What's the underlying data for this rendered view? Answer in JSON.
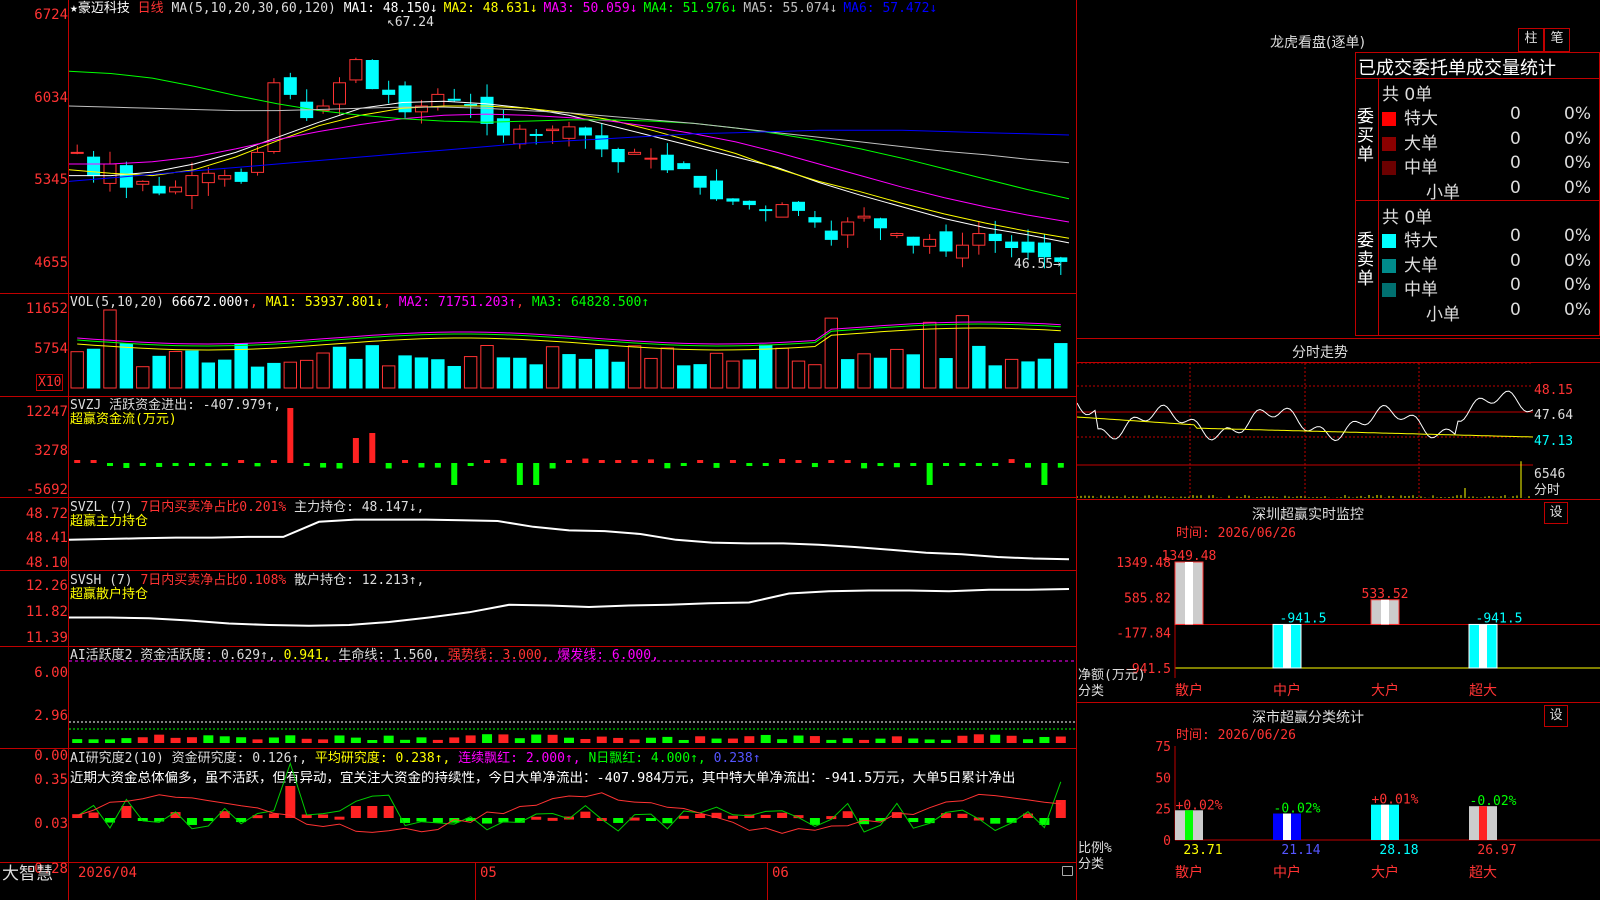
{
  "header": {
    "stock_name": "★豪迈科技",
    "period": "日线",
    "ma_label": "MA(5,10,20,30,60,120)",
    "ma_values": [
      {
        "text": "MA1: 48.150↓",
        "color": "#ffffff"
      },
      {
        "text": "MA2: 48.631↓",
        "color": "#ffff00"
      },
      {
        "text": "MA3: 50.059↓",
        "color": "#ff00ff"
      },
      {
        "text": "MA4: 51.976↓",
        "color": "#00ff00"
      },
      {
        "text": "MA5: 55.074↓",
        "color": "#c0c0c0"
      },
      {
        "text": "MA6: 57.472↓",
        "color": "#0000ff"
      }
    ],
    "high_mark": "67.24",
    "low_mark": "46.55"
  },
  "axes": {
    "price": [
      "6724",
      "6034",
      "5345",
      "4655"
    ],
    "vol": [
      "11652",
      "5754",
      "X10"
    ],
    "svzj": [
      "12247",
      "3278",
      "-5692"
    ],
    "svzl": [
      "48.72",
      "48.41",
      "48.10"
    ],
    "svsh": [
      "12.26",
      "11.82",
      "11.39"
    ],
    "ai1": [
      "6.00",
      "2.96",
      "0.00"
    ],
    "ai2": [
      "0.35",
      "0.03",
      "-0.28"
    ]
  },
  "vol_panel": {
    "label": "VOL(5,10,20)",
    "value": "66672.000↑",
    "ma1": "MA1: 53937.801↓",
    "ma2": "MA2: 71751.203↑",
    "ma3": "MA3: 64828.500↑"
  },
  "svzj_panel": {
    "label": "SVZJ  活跃资金进出: -407.979↑,",
    "sub": "超赢资金流(万元)"
  },
  "svzl_panel": {
    "label": "SVZL (7)",
    "ratio": "7日内买卖净占比0.201%",
    "hold": "主力持仓: 48.147↓,",
    "sub": "超赢主力持仓"
  },
  "svsh_panel": {
    "label": "SVSH (7)",
    "ratio": "7日内买卖净占比0.108%",
    "hold": "散户持仓: 12.213↑,",
    "sub": "超赢散户持仓"
  },
  "ai1_panel": {
    "label": "AI活跃度2 资金活跃度: 0.629↑,",
    "v2": "0.941,",
    "life": "生命线: 1.560,",
    "strong": "强势线: 3.000,",
    "burst": "爆发线: 6.000,"
  },
  "ai2_panel": {
    "label": "AI研究度2(10) 资金研究度: 0.126↑,",
    "avg": "平均研究度: 0.238↑,",
    "cont": "连续飘红: 2.000↑,",
    "nday": "N日飘红: 4.000↑,",
    "last": "0.238↑",
    "commentary": "近期大资金总体偏多，虽不活跃，但有异动，宜关注大资金的持续性，今日大单净流出：-407.984万元，其中特大单净流出：-941.5万元，大单5日累计净出"
  },
  "bottom": {
    "brand": "大智慧",
    "date_start": "2026/04",
    "month_05": "05",
    "month_06": "06"
  },
  "lhb": {
    "title": "龙虎看盘(逐单)",
    "btn_zhu": "柱",
    "btn_bi": "笔",
    "tabs": [
      "已成交",
      "委托单",
      "成交量统计"
    ],
    "buy_label": "委买单",
    "sell_label": "委卖单",
    "buy_total": "共 0单",
    "sell_total": "共 0单",
    "buy_rows": [
      {
        "name": "特大",
        "val": "0",
        "pct": "0%",
        "color": "#ff0000"
      },
      {
        "name": "大单",
        "val": "0",
        "pct": "0%",
        "color": "#8b0000"
      },
      {
        "name": "中单",
        "val": "0",
        "pct": "0%",
        "color": "#6b0000"
      },
      {
        "name": "小单",
        "val": "0",
        "pct": "0%",
        "color": ""
      }
    ],
    "sell_rows": [
      {
        "name": "特大",
        "val": "0",
        "pct": "0%",
        "color": "#00ffff"
      },
      {
        "name": "大单",
        "val": "0",
        "pct": "0%",
        "color": "#008b8b"
      },
      {
        "name": "中单",
        "val": "0",
        "pct": "0%",
        "color": "#007070"
      },
      {
        "name": "小单",
        "val": "0",
        "pct": "0%",
        "color": ""
      }
    ]
  },
  "intraday": {
    "title": "分时走势",
    "prices": [
      "48.15",
      "47.64",
      "47.13"
    ],
    "vol_label": "6546",
    "fen": "分时"
  },
  "monitor": {
    "title": "深圳超赢实时监控",
    "btn": "设",
    "time": "时间: 2026/06/26",
    "axis": [
      "1349.48",
      "585.82",
      "-177.84",
      "-941.5"
    ],
    "net_label": "净额(万元)",
    "cat_label": "分类",
    "categories": [
      "散户",
      "中户",
      "大户",
      "超大"
    ],
    "values": [
      1349.48,
      -941.5,
      533.52,
      -941.5
    ],
    "value_labels": [
      "1349.48",
      "-941.5",
      "533.52",
      "-941.5"
    ]
  },
  "classify": {
    "title": "深市超赢分类统计",
    "btn": "设",
    "time": "时间: 2026/06/26",
    "axis": [
      "75",
      "50",
      "25",
      "0"
    ],
    "ratio_label": "比例%",
    "cat_label": "分类",
    "categories": [
      "散户",
      "中户",
      "大户",
      "超大"
    ],
    "values": [
      23.71,
      21.14,
      28.18,
      26.97
    ],
    "value_labels": [
      "23.71",
      "21.14",
      "28.18",
      "26.97"
    ],
    "changes": [
      "+0.02%",
      "-0.02%",
      "+0.01%",
      "-0.02%"
    ]
  }
}
